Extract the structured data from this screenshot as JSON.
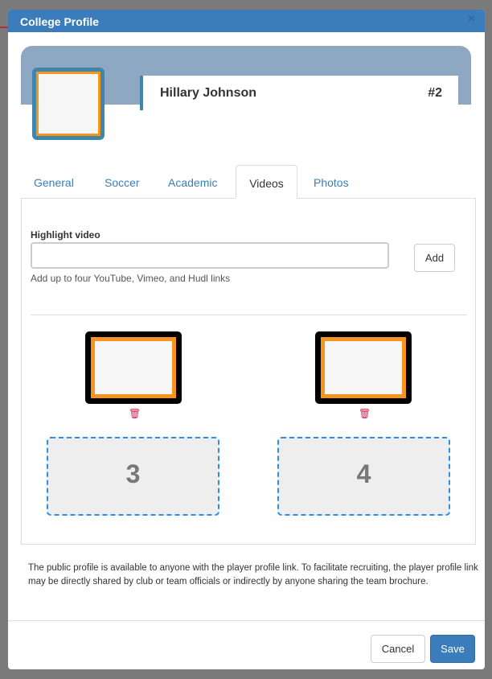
{
  "modal": {
    "title": "College Profile",
    "close": "×"
  },
  "profile": {
    "name": "Hillary Johnson",
    "number": "#2"
  },
  "tabs": [
    {
      "label": "General"
    },
    {
      "label": "Soccer"
    },
    {
      "label": "Academic"
    },
    {
      "label": "Videos",
      "active": true
    },
    {
      "label": "Photos"
    }
  ],
  "videos": {
    "label": "Highlight video",
    "input_value": "",
    "add_label": "Add",
    "help": "Add up to four YouTube, Vimeo, and Hudl links",
    "slots": [
      "3",
      "4"
    ],
    "trash_icon": "trash-icon"
  },
  "footer": {
    "notice": "The public profile is available to anyone with the player profile link. To facilitate recruiting, the player profile link may be directly shared by club or team officials or indirectly by anyone sharing the team brochure.",
    "cancel": "Cancel",
    "save": "Save"
  },
  "colors": {
    "header": "#3a7dba",
    "accent": "#f7941d",
    "delete": "#d0284e",
    "slot_border": "#2b8ee8"
  }
}
